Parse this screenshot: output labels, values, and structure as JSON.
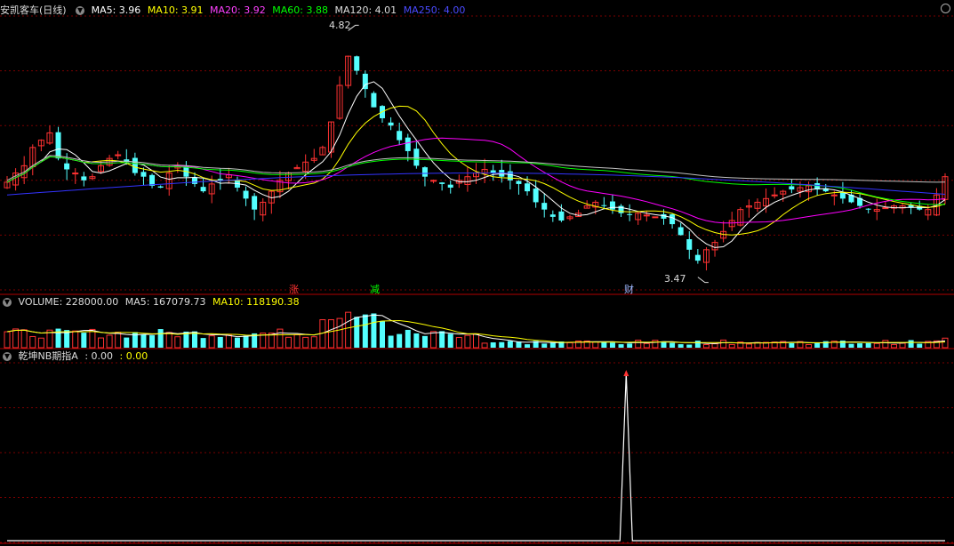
{
  "main_legend": {
    "stock_name": "安凯客车(日线)",
    "ma5": "MA5: 3.96",
    "ma10": "MA10: 3.91",
    "ma20": "MA20: 3.92",
    "ma60": "MA60: 3.88",
    "ma120": "MA120: 4.01",
    "ma250": "MA250: 4.00"
  },
  "volume_legend": {
    "volume": "VOLUME: 228000.00",
    "ma5": "MA5: 167079.73",
    "ma10": "MA10: 118190.38"
  },
  "indicator_legend": {
    "name": "乾坤NB期指A",
    "v1": ": 0.00",
    "v2": ": 0.00"
  },
  "annotations": {
    "high_label": "4.82",
    "low_label": "3.47",
    "marker_zhang": "涨",
    "marker_jian": "减",
    "marker_cai": "财"
  },
  "colors": {
    "up": "#ff3232",
    "down": "#54ffff",
    "ma5": "#ffffff",
    "ma10": "#ffff00",
    "ma20": "#ff00ff",
    "ma60": "#00ff00",
    "ma120": "#c0c0c0",
    "ma250": "#3333ff",
    "grid": "#7a0000"
  },
  "chart_data": {
    "type": "candlestick",
    "price_ylim": [
      3.4,
      4.9
    ],
    "high": 4.82,
    "low": 3.47,
    "closes": [
      3.99,
      4.04,
      4.08,
      4.18,
      4.22,
      4.26,
      4.12,
      4.06,
      4.04,
      4.0,
      4.02,
      4.08,
      4.12,
      4.14,
      4.1,
      4.04,
      4.02,
      3.97,
      3.96,
      4.04,
      4.08,
      4.02,
      3.98,
      3.94,
      3.98,
      4.0,
      4.03,
      3.96,
      3.9,
      3.84,
      3.88,
      3.94,
      4.0,
      4.04,
      4.07,
      4.1,
      4.12,
      4.18,
      4.32,
      4.52,
      4.68,
      4.6,
      4.5,
      4.4,
      4.34,
      4.3,
      4.22,
      4.16,
      4.08,
      4.02,
      4.0,
      3.98,
      3.96,
      4.0,
      4.02,
      4.04,
      4.06,
      4.04,
      4.02,
      4.0,
      3.98,
      3.94,
      3.88,
      3.84,
      3.8,
      3.78,
      3.8,
      3.82,
      3.86,
      3.88,
      3.86,
      3.84,
      3.82,
      3.81,
      3.82,
      3.81,
      3.8,
      3.79,
      3.76,
      3.7,
      3.62,
      3.56,
      3.62,
      3.66,
      3.72,
      3.78,
      3.84,
      3.86,
      3.88,
      3.9,
      3.92,
      3.94,
      3.95,
      3.96,
      3.97,
      3.95,
      3.94,
      3.92,
      3.9,
      3.88,
      3.86,
      3.84,
      3.84,
      3.85,
      3.86,
      3.86,
      3.85,
      3.84,
      3.84,
      3.92,
      4.02
    ],
    "volume_max": 228000,
    "volume_last": 228000,
    "indicator": {
      "name": "乾坤NB期指A",
      "spike_at_fraction": 0.66,
      "baseline": 0,
      "spike_value": 1
    },
    "markers": [
      {
        "label": "涨",
        "color": "#ff3232"
      },
      {
        "label": "减",
        "color": "#00ff00"
      },
      {
        "label": "财",
        "color": "#9fb8ff"
      }
    ]
  }
}
